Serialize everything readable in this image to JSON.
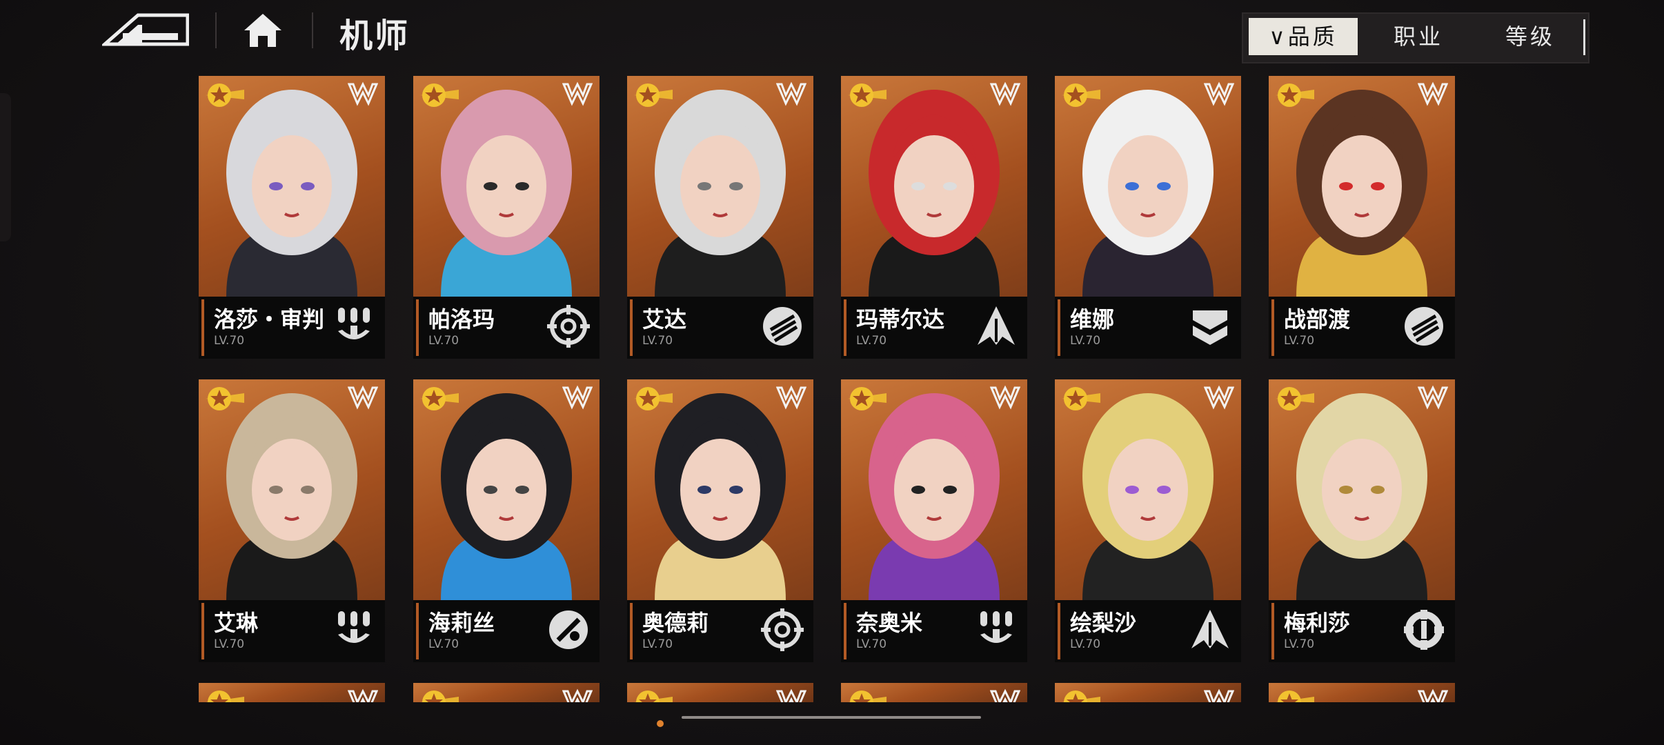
{
  "header": {
    "title": "机师",
    "back_icon": "back-arrow-icon",
    "home_icon": "home-icon"
  },
  "sort": {
    "tabs": [
      {
        "label": "品质",
        "active": true,
        "indicator": "∨"
      },
      {
        "label": "职业",
        "active": false
      },
      {
        "label": "等级",
        "active": false
      }
    ]
  },
  "colors": {
    "card_accent": "#b25a25",
    "background": "#141213",
    "star_gold": "#f2c230"
  },
  "pilots": [
    {
      "name": "洛莎・审判",
      "level": "LV.70",
      "class_icon": "missile-class-icon",
      "palette": [
        "#d8d8dc",
        "#2a2a33",
        "#7a5cc0"
      ]
    },
    {
      "name": "帕洛玛",
      "level": "LV.70",
      "class_icon": "target-class-icon",
      "palette": [
        "#d99aae",
        "#3aa6d6",
        "#2a2a2a"
      ]
    },
    {
      "name": "艾达",
      "level": "LV.70",
      "class_icon": "fist-class-icon",
      "palette": [
        "#d9d9d9",
        "#1e1e1e",
        "#777"
      ]
    },
    {
      "name": "玛蒂尔达",
      "level": "LV.70",
      "class_icon": "arrow-class-icon",
      "palette": [
        "#c8292c",
        "#1a1a1a",
        "#ddd"
      ]
    },
    {
      "name": "维娜",
      "level": "LV.70",
      "class_icon": "shield-class-icon",
      "palette": [
        "#f0f0f0",
        "#2a2431",
        "#3c6fd6"
      ]
    },
    {
      "name": "战部渡",
      "level": "LV.70",
      "class_icon": "fist-class-icon",
      "palette": [
        "#5b3422",
        "#e0b242",
        "#d32b2b"
      ]
    },
    {
      "name": "艾琳",
      "level": "LV.70",
      "class_icon": "missile-class-icon",
      "palette": [
        "#c9b79b",
        "#1a1a1a",
        "#8a7a6a"
      ]
    },
    {
      "name": "海莉丝",
      "level": "LV.70",
      "class_icon": "sword-class-icon",
      "palette": [
        "#1e1e22",
        "#2f8fd8",
        "#444"
      ]
    },
    {
      "name": "奥德莉",
      "level": "LV.70",
      "class_icon": "target-class-icon",
      "palette": [
        "#1f1f24",
        "#e8cf8e",
        "#2d3a66"
      ]
    },
    {
      "name": "奈奥米",
      "level": "LV.70",
      "class_icon": "missile-class-icon",
      "palette": [
        "#d8638c",
        "#7a3bb0",
        "#222"
      ]
    },
    {
      "name": "绘梨沙",
      "level": "LV.70",
      "class_icon": "arrow-class-icon",
      "palette": [
        "#e3cf7a",
        "#222",
        "#9c5cd2"
      ]
    },
    {
      "name": "梅利莎",
      "level": "LV.70",
      "class_icon": "wrench-class-icon",
      "palette": [
        "#e2d6a6",
        "#1f1f1f",
        "#b08a3a"
      ]
    }
  ],
  "partial_row_count": 6
}
